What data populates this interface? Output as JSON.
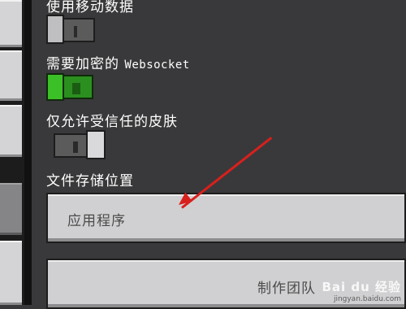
{
  "settings": {
    "use_mobile_data_label": "使用移动数据",
    "encrypted_ws_label_prefix": "需要加密的 ",
    "encrypted_ws_label_mono": "Websocket",
    "trusted_skins_label": "仅允许受信任的皮肤",
    "file_storage_label": "文件存储位置",
    "file_storage_value": "应用程序",
    "team_button_label": "制作团队"
  },
  "toggles": {
    "use_mobile_data": "off",
    "require_encrypted_websocket": "on",
    "trusted_skins_only": "off"
  },
  "watermark": {
    "main": "Bai du 经验",
    "sub": "jingyan.baidu.com"
  },
  "colors": {
    "background": "#39393b",
    "toggle_on": "#3cc027",
    "annotation_arrow": "#d8201c"
  }
}
